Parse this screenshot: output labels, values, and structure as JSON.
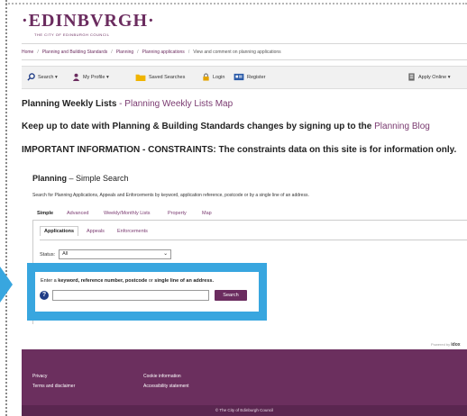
{
  "header": {
    "logo_text": "·EDINBVRGH·",
    "logo_subtitle": "THE CITY OF EDINBURGH COUNCIL"
  },
  "breadcrumb": {
    "items": [
      "Home",
      "Planning and Building Standards",
      "Planning",
      "Planning applications",
      "View and comment on planning applications"
    ],
    "separator": "/"
  },
  "toolbar": {
    "search_label": "Search ▾",
    "profile_label": "My Profile ▾",
    "saved_label": "Saved Searches",
    "login_label": "Login",
    "register_label": "Register",
    "apply_label": "Apply Online ▾"
  },
  "notices": {
    "weekly_lists": "Planning Weekly Lists",
    "weekly_separator": " - ",
    "weekly_map_link": "Planning Weekly Lists Map",
    "keep_up_text": "Keep up to date with Planning & Building Standards changes by signing up to the ",
    "blog_link": "Planning Blog",
    "important": "IMPORTANT INFORMATION - CONSTRAINTS: The constraints data on this site is for information only."
  },
  "search": {
    "title": "Planning",
    "title_sep": " – ",
    "subtitle": "Simple Search",
    "description": "Search for Planning Applications, Appeals and Enforcements by keyword, application reference, postcode or by a single line of an address.",
    "tabs": [
      "Simple",
      "Advanced",
      "Weekly/Monthly Lists",
      "Property",
      "Map"
    ],
    "subtabs": [
      "Applications",
      "Appeals",
      "Enforcements"
    ],
    "status_label": "Status:",
    "status_value": "All",
    "instruction_prefix": "Enter a ",
    "instruction_bold": "keyword, reference number, postcode",
    "instruction_mid": " or ",
    "instruction_bold2": "single line of an address.",
    "input_value": "",
    "help_symbol": "?",
    "button_label": "Search"
  },
  "powered": {
    "prefix": "Powered by",
    "brand": "idox"
  },
  "footer": {
    "privacy": "Privacy",
    "terms": "Terms and disclaimer",
    "cookie": "Cookie information",
    "accessibility": "Accessibility statement",
    "copyright": "© The City of Edinburgh Council"
  },
  "colors": {
    "brand": "#6b2c5f",
    "highlight": "#38a6df",
    "help_icon": "#1f3c86",
    "footer": "#6b2f5e"
  }
}
